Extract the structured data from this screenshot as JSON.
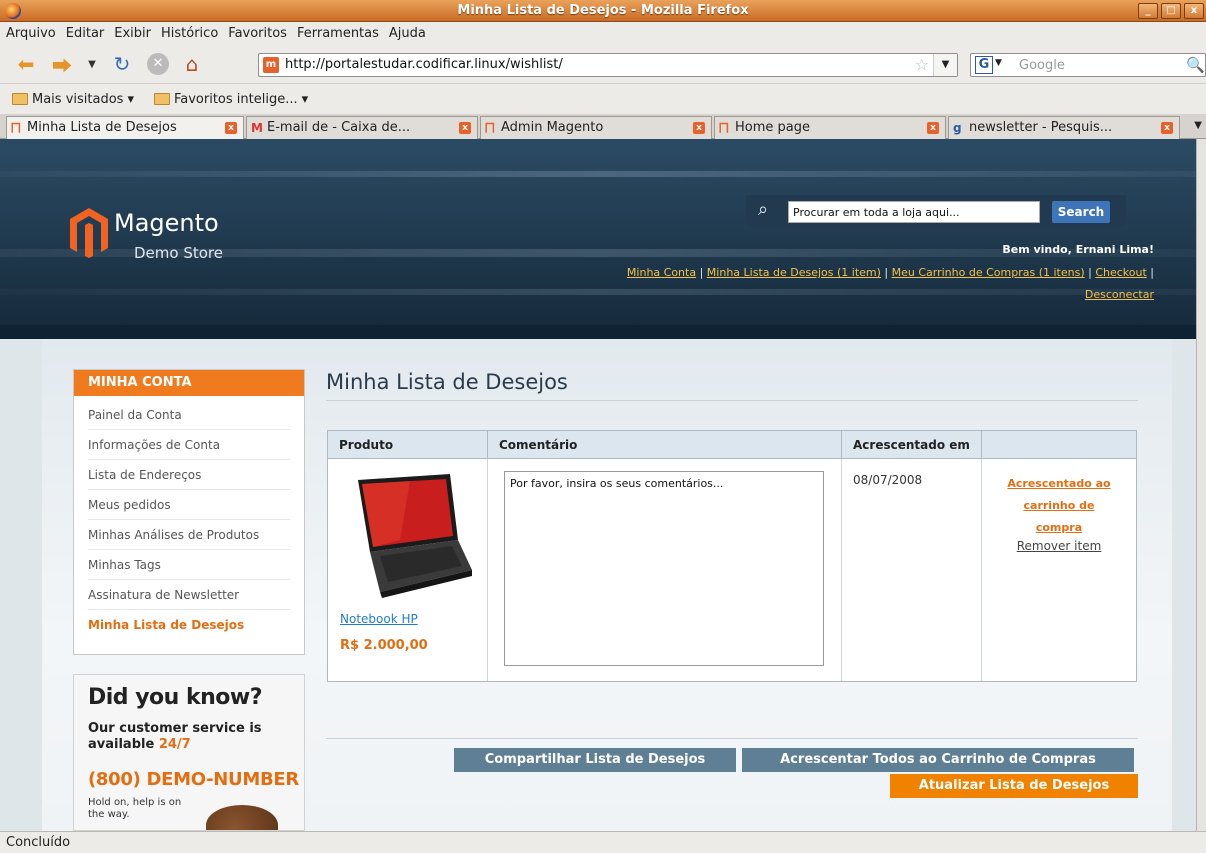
{
  "window": {
    "title": "Minha Lista de Desejos - Mozilla Firefox",
    "buttons": [
      "_",
      "□",
      "x"
    ]
  },
  "menu": [
    "Arquivo",
    "Editar",
    "Exibir",
    "Histórico",
    "Favoritos",
    "Ferramentas",
    "Ajuda"
  ],
  "navbar": {
    "url": "http://portalestudar.codificar.linux/wishlist/",
    "search_placeholder": "Google"
  },
  "bookmarks": [
    "Mais visitados",
    "Favoritos intelige..."
  ],
  "tabs": [
    {
      "label": "Minha Lista de Desejos",
      "icon": "magento-icon"
    },
    {
      "label": "E-mail de  - Caixa de...",
      "icon": "gmail-icon"
    },
    {
      "label": "Admin Magento",
      "icon": "magento-icon"
    },
    {
      "label": "Home page",
      "icon": "magento-icon"
    },
    {
      "label": "newsletter - Pesquis...",
      "icon": "google-icon"
    }
  ],
  "store": {
    "logo_name": "Magento",
    "logo_sub": "Demo Store",
    "search_placeholder": "Procurar em toda a loja aqui...",
    "search_button": "Search",
    "welcome": "Bem vindo, Ernani Lima!",
    "links": [
      "Minha Conta",
      "Minha Lista de Desejos (1 item)",
      "Meu Carrinho de Compras (1 itens)",
      "Checkout",
      "Desconectar"
    ]
  },
  "sidebar": {
    "title": "MINHA CONTA",
    "items": [
      "Painel da Conta",
      "Informações de Conta",
      "Lista de Endereços",
      "Meus pedidos",
      "Minhas Análises de Produtos",
      "Minhas Tags",
      "Assinatura de Newsletter",
      "Minha Lista de Desejos"
    ]
  },
  "promo": {
    "heading": "Did you know?",
    "line1": "Our customer service is available",
    "hours": "24/7",
    "phone": "(800) DEMO-NUMBER",
    "hold": "Hold on, help is on the way."
  },
  "page": {
    "title": "Minha Lista de Desejos"
  },
  "wishlist": {
    "headers": [
      "Produto",
      "Comentário",
      "Acrescentado em",
      ""
    ],
    "item": {
      "name": "Notebook HP",
      "price": "R$ 2.000,00",
      "comment": "Por favor, insira os seus comentários...",
      "date": "08/07/2008",
      "action_add": "Acrescentado ao carrinho de compra",
      "action_remove": "Remover item"
    }
  },
  "buttons": {
    "share": "Compartilhar Lista de Desejos",
    "add_all": "Acrescentar Todos ao Carrinho de Compras",
    "update": "Atualizar Lista de Desejos"
  },
  "status": "Concluído",
  "colors": {
    "accent_orange": "#f18200",
    "header_blue": "#1c3346",
    "button_slate": "#5f7f94"
  }
}
